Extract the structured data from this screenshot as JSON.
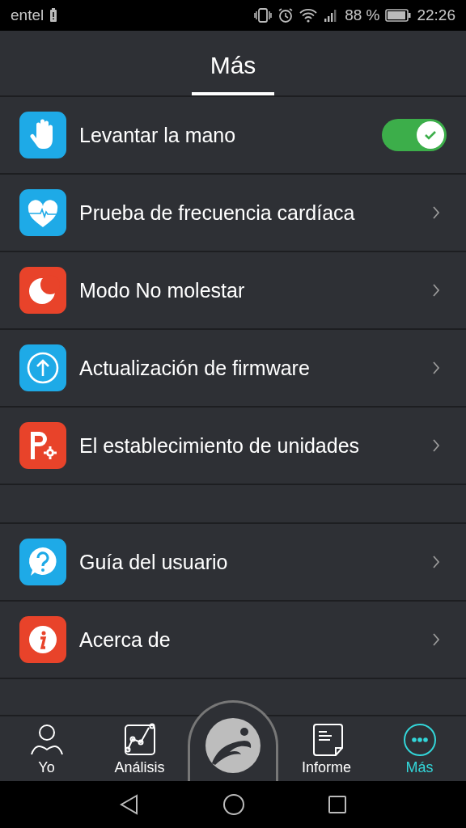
{
  "status_bar": {
    "carrier": "entel",
    "battery": "88 %",
    "time": "22:26"
  },
  "header": {
    "title": "Más"
  },
  "groups": [
    {
      "items": [
        {
          "kind": "toggle",
          "color": "#1eaae7",
          "label": "Levantar la mano",
          "on": true
        },
        {
          "kind": "link",
          "color": "#1eaae7",
          "label": "Prueba de frecuencia cardíaca"
        },
        {
          "kind": "link",
          "color": "#e8432a",
          "label": "Modo No molestar"
        },
        {
          "kind": "link",
          "color": "#1eaae7",
          "label": "Actualización de firmware"
        },
        {
          "kind": "link",
          "color": "#e8432a",
          "label": "El establecimiento de unidades"
        }
      ]
    },
    {
      "items": [
        {
          "kind": "link",
          "color": "#1eaae7",
          "label": "Guía del usuario"
        },
        {
          "kind": "link",
          "color": "#e8432a",
          "label": "Acerca de"
        }
      ]
    }
  ],
  "tab_bar": [
    {
      "kind": "tab",
      "label": "Yo",
      "selected": false
    },
    {
      "kind": "tab",
      "label": "Análisis",
      "selected": false
    },
    {
      "kind": "center"
    },
    {
      "kind": "tab",
      "label": "Informe",
      "selected": false
    },
    {
      "kind": "tab",
      "label": "Más",
      "selected": true
    }
  ]
}
